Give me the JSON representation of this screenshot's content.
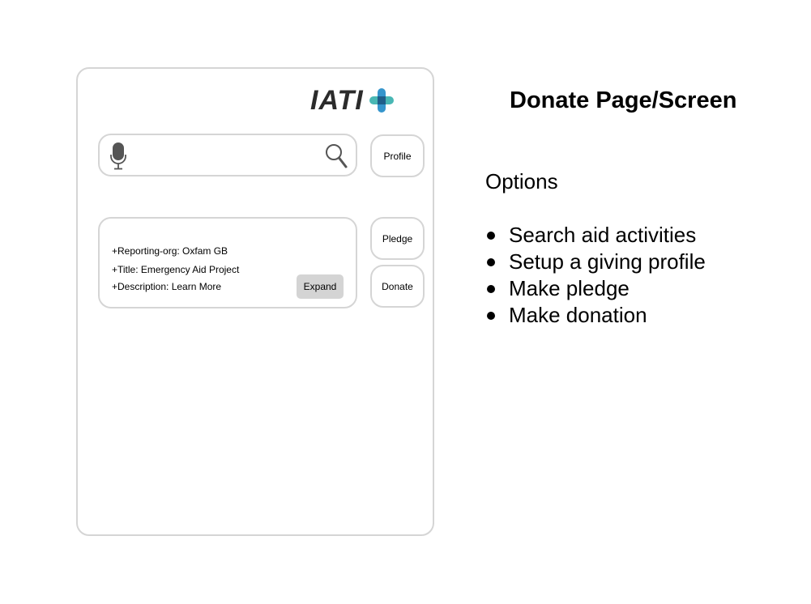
{
  "logo": {
    "text": "IATI",
    "cross_colors": [
      "#2a8fc9",
      "#1f5e8a",
      "#3fb3b0"
    ]
  },
  "search": {
    "placeholder": "",
    "value": ""
  },
  "buttons": {
    "profile": "Profile",
    "pledge": "Pledge",
    "donate": "Donate",
    "expand": "Expand"
  },
  "activity": {
    "reporting_org": "+Reporting-org: Oxfam GB",
    "title": "+Title: Emergency Aid Project",
    "description": "+Description: Learn More"
  },
  "notes": {
    "heading": "Donate Page/Screen",
    "options_heading": "Options",
    "options": [
      "Search aid activities",
      "Setup a giving profile",
      "Make pledge",
      "Make donation"
    ]
  },
  "colors": {
    "border": "#d5d5d5",
    "expand_bg": "#d4d4d4",
    "icon": "#555555"
  }
}
